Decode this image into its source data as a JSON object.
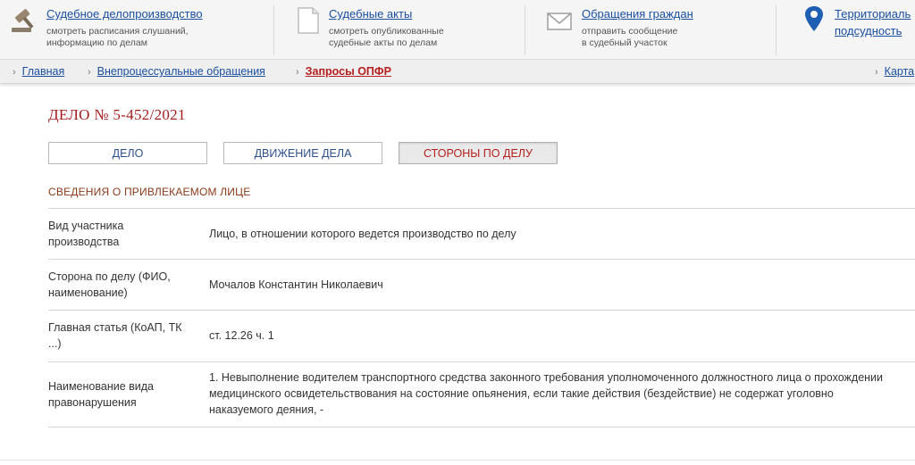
{
  "services": [
    {
      "title": "Судебное делопроизводство",
      "desc1": "смотреть расписания слушаний,",
      "desc2": "информацию по делам",
      "icon": "gavel-icon"
    },
    {
      "title": "Судебные акты",
      "desc1": "смотреть опубликованные",
      "desc2": "судебные акты по делам",
      "icon": "document-icon"
    },
    {
      "title": "Обращения граждан",
      "desc1": "отправить сообщение",
      "desc2": "в судебный участок",
      "icon": "envelope-icon"
    },
    {
      "title1": "Территориаль",
      "title2": "подсудность",
      "icon": "map-pin-icon"
    }
  ],
  "breadcrumbs": {
    "home": "Главная",
    "section": "Внепроцессуальные обращения",
    "current": "Запросы ОПФР",
    "right": "Карта"
  },
  "case": {
    "title": "ДЕЛО № 5-452/2021",
    "tabs": [
      "ДЕЛО",
      "ДВИЖЕНИЕ ДЕЛА",
      "СТОРОНЫ ПО ДЕЛУ"
    ],
    "active_tab": "СТОРОНЫ ПО ДЕЛУ",
    "section_title": "СВЕДЕНИЯ О ПРИВЛЕКАЕМОМ ЛИЦЕ",
    "rows": [
      {
        "key1": "Вид участника",
        "key2": "производства",
        "value": "Лицо, в отношении которого ведется производство по делу"
      },
      {
        "key1": "Сторона по делу (ФИО,",
        "key2": "наименование)",
        "value": "Мочалов Константин Николаевич"
      },
      {
        "key1": "Главная статья (КоАП, ТК",
        "key2": "...)",
        "value": "ст. 12.26 ч. 1"
      },
      {
        "key1": "Наименование вида",
        "key2": "правонарушения",
        "value1": "1. Невыполнение водителем транспортного средства законного требования уполномоченного должностного лица о прохождении",
        "value2": "медицинского освидетельствования на состояние опьянения, если такие действия (бездействие) не содержат уголовно",
        "value3": "наказуемого деяния, -"
      }
    ]
  },
  "colors": {
    "link": "#1a4fa0",
    "accent_red": "#b51f1f",
    "title_red": "#a41d1d",
    "section_brown": "#8a3a1a"
  }
}
